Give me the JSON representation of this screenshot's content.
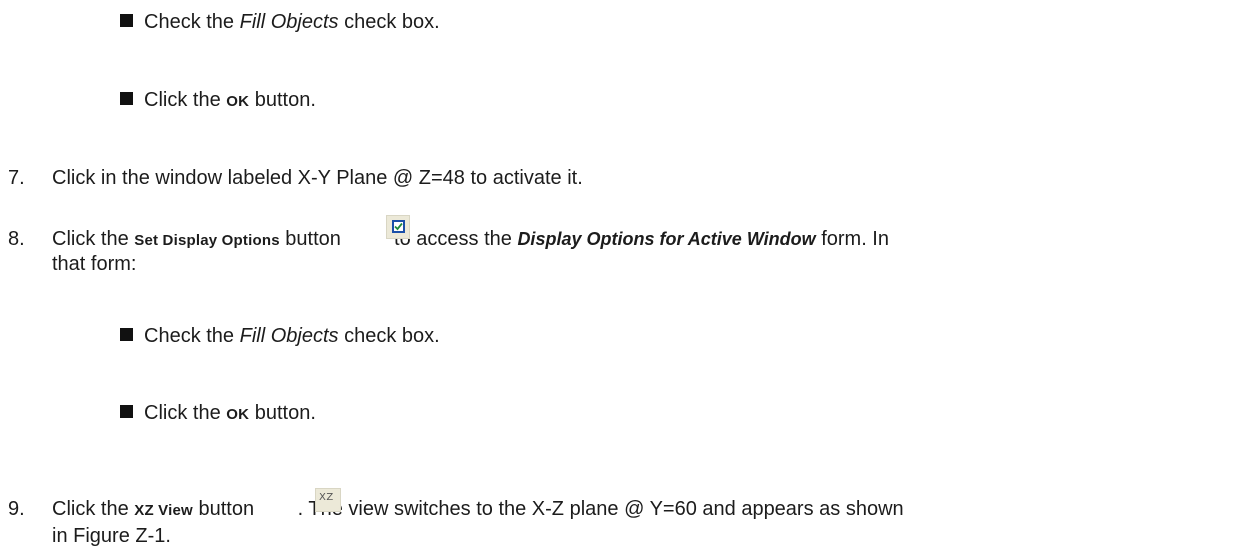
{
  "bullets_group1": {
    "item1": {
      "pre": "Check the ",
      "em": "Fill Objects",
      "post": " check box."
    },
    "item2": {
      "pre": "Click the ",
      "bold": "OK",
      "post": " button."
    }
  },
  "step7": {
    "number": "7.",
    "text": "Click in the window labeled X-Y Plane @ Z=48 to activate it."
  },
  "step8": {
    "number": "8.",
    "pre": "Click the ",
    "bold": "Set Display Options",
    "mid": " button ",
    "after_icon": " to access the ",
    "bolditalic": "Display Options for Active Window",
    "post": " form. In",
    "continuation": "that form:",
    "icon": "set-display-options-checkbox-icon"
  },
  "bullets_group2": {
    "item1": {
      "pre": "Check the ",
      "em": "Fill Objects",
      "post": " check box."
    },
    "item2": {
      "pre": "Click the ",
      "bold": "OK",
      "post": " button."
    }
  },
  "step9": {
    "number": "9.",
    "pre": "Click the ",
    "bold": "XZ View",
    "mid": " button ",
    "icon_label": "XZ",
    "post": ". The view switches to the X-Z plane @ Y=60 and appears as shown",
    "continuation": "in Figure Z-1."
  },
  "colors": {
    "text": "#1c1c1c",
    "icon_face": "#ece9d8",
    "checkbox_border": "#1a4fa8",
    "checkmark": "#1f8a3b"
  }
}
